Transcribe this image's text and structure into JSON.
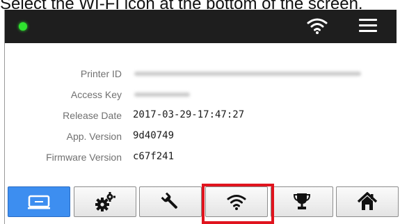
{
  "caption": "Select the WI-FI icon at the bottom of the screen.",
  "status_bar": {
    "led_color": "#2fe42f",
    "icons": [
      "wifi-icon",
      "menu-icon"
    ]
  },
  "info": {
    "rows": [
      {
        "label": "Printer ID",
        "value": ""
      },
      {
        "label": "Access Key",
        "value": ""
      },
      {
        "label": "Release Date",
        "value": "2017-03-29-17:47:27"
      },
      {
        "label": "App. Version",
        "value": "9d40749"
      },
      {
        "label": "Firmware Version",
        "value": "c67f241"
      }
    ]
  },
  "tabs": [
    {
      "icon": "printer-icon",
      "active": true
    },
    {
      "icon": "gears-icon",
      "active": false
    },
    {
      "icon": "wrench-icon",
      "active": false
    },
    {
      "icon": "wifi-icon",
      "active": false,
      "highlighted": true
    },
    {
      "icon": "trophy-icon",
      "active": false
    },
    {
      "icon": "home-icon",
      "active": false
    }
  ],
  "colors": {
    "accent_active_tab": "#3d8ef0",
    "highlight": "#e0141e",
    "status_bar": "#1e1e1e"
  }
}
